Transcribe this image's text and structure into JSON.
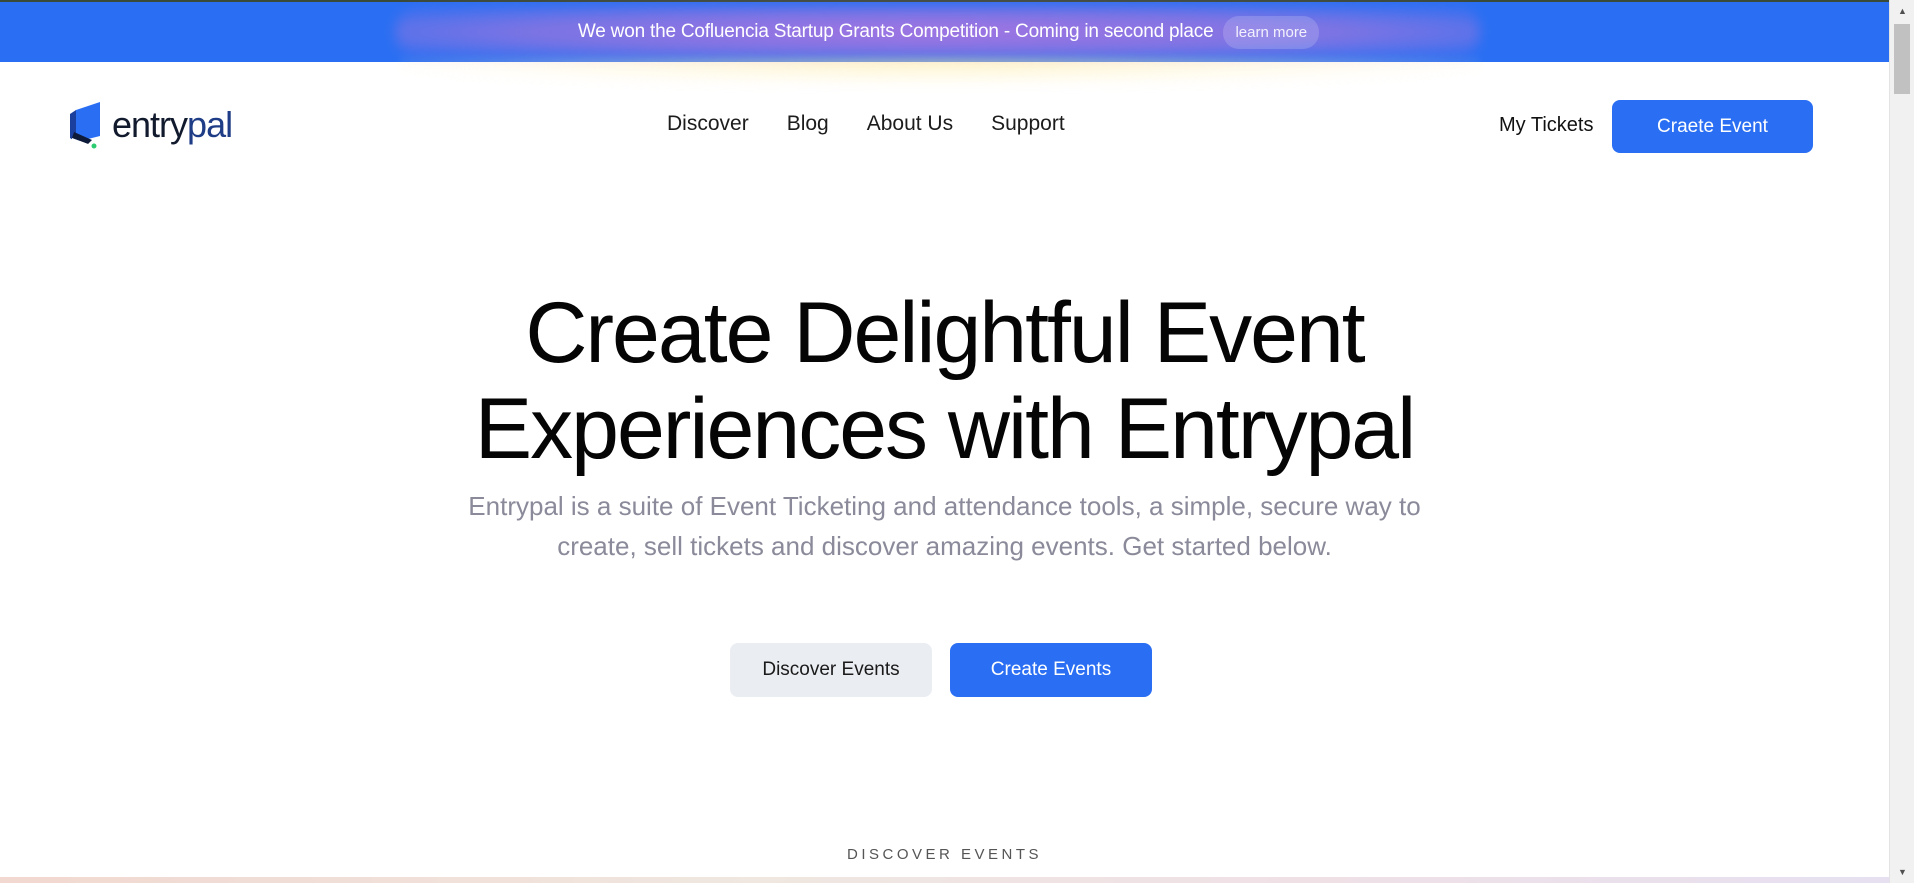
{
  "banner": {
    "text": "We won the Cofluencia Startup Grants Competition - Coming in second place",
    "link_label": "learn more"
  },
  "header": {
    "logo_text_a": "entry",
    "logo_text_b": "pal",
    "nav": [
      "Discover",
      "Blog",
      "About Us",
      "Support"
    ],
    "my_tickets": "My Tickets",
    "create_event_button": "Craete Event"
  },
  "hero": {
    "title_line1": "Create Delightful Event",
    "title_line2": "Experiences with Entrypal",
    "subtitle_line1": "Entrypal is a suite of Event Ticketing and attendance tools, a simple, secure way to",
    "subtitle_line2": "create, sell tickets and discover amazing events. Get started below.",
    "discover_button": "Discover Events",
    "create_button": "Create Events"
  },
  "section": {
    "label": "DISCOVER EVENTS"
  },
  "scrollbar": {
    "up_icon": "▲",
    "down_icon": "▼"
  },
  "colors": {
    "accent": "#2a6ff3",
    "secondary_button": "#eaedf2",
    "subtitle_text": "#8a8a9a"
  }
}
